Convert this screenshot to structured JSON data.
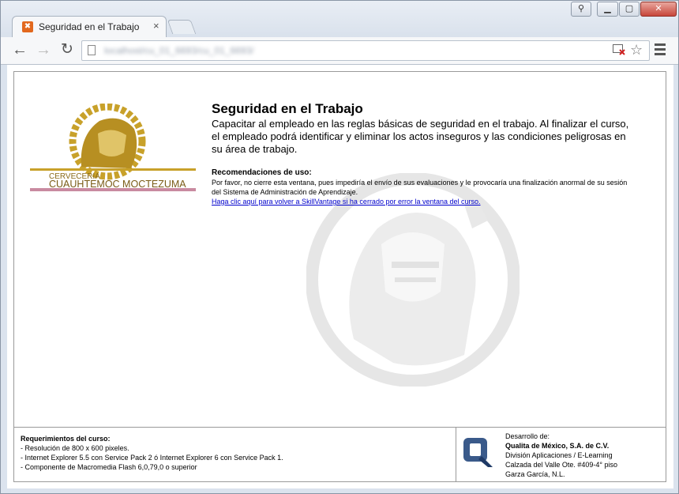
{
  "browser": {
    "tab_title": "Seguridad en el Trabajo",
    "tab_close": "×",
    "url": "localhost/cu_01_6693/cu_01_6693/",
    "window_controls": {
      "minimize": "▁",
      "maximize": "▢",
      "close": "✕",
      "user": "⚲"
    },
    "nav": {
      "back": "←",
      "forward": "→",
      "reload": "↻"
    },
    "star": "☆"
  },
  "page": {
    "logo_text_line1": "CERVECERIA",
    "logo_text_line2": "CUAUHTEMOC MOCTEZUMA",
    "course_title": "Seguridad en el Trabajo",
    "course_description": "Capacitar al empleado en las reglas básicas de seguridad en el trabajo. Al finalizar el curso, el empleado podrá identificar y eliminar los actos inseguros y las condiciones peligrosas en su área de trabajo.",
    "recommendations_title": "Recomendaciones de uso:",
    "recommendations_text": "Por favor, no cierre esta ventana, pues impediría el envío de sus evaluaciones y le provocaría una finalización anormal de su sesión del Sistema de Administración de Aprendizaje.",
    "return_link": "Haga clic aquí para volver a SkillVantage si ha cerrado por error la ventana del curso."
  },
  "requirements": {
    "title": "Requerimientos del curso:",
    "items": [
      "- Resolución de 800 x 600 pixeles.",
      "- Internet Explorer 5.5 con Service Pack 2 ó Internet Explorer 6 con Service Pack 1.",
      "- Componente de Macromedia Flash 6,0,79,0 o superior"
    ]
  },
  "developer": {
    "label": "Desarrollo de:",
    "company": "Qualita de México, S.A. de C.V.",
    "division": "División Aplicaciones / E-Learning",
    "address": "Calzada del Valle Ote. #409-4° piso",
    "city": "Garza García, N.L."
  },
  "colors": {
    "logo_gold": "#c8a12a",
    "logo_stripe_pink": "#c98aa0",
    "link_blue": "#0000cc",
    "qualita_blue": "#3a5a8a"
  }
}
